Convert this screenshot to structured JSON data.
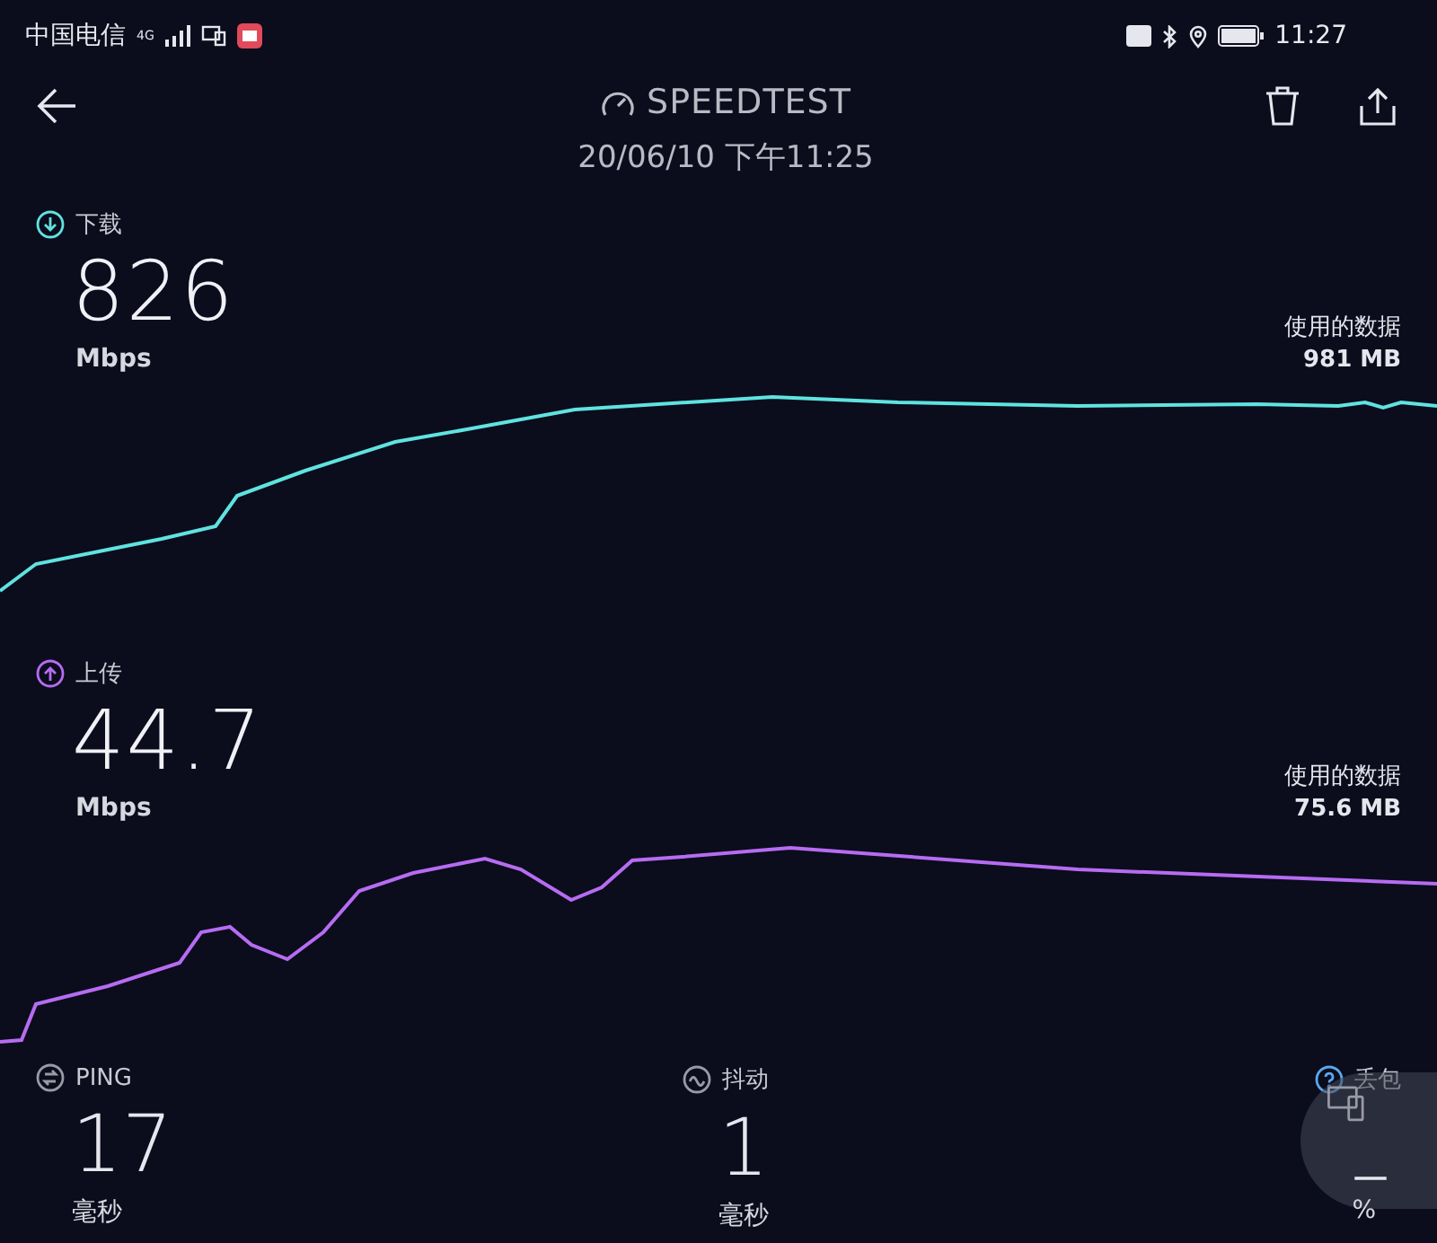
{
  "status_bar": {
    "carrier": "中国电信",
    "network": "4G",
    "time": "11:27"
  },
  "header": {
    "title": "SPEEDTEST",
    "date": "20/06/10 下午11:25"
  },
  "tests": [
    {
      "kind": "download",
      "label": "下载",
      "value": "826",
      "unit": "Mbps",
      "data_label": "使用的数据",
      "data_value": "981 MB",
      "color": "#5fe3e0"
    },
    {
      "kind": "upload",
      "label": "上传",
      "value": "44.7",
      "unit": "Mbps",
      "data_label": "使用的数据",
      "data_value": "75.6 MB",
      "color": "#b66cf2"
    }
  ],
  "metrics": [
    {
      "kind": "ping",
      "label": "PING",
      "value": "17",
      "unit": "毫秒"
    },
    {
      "kind": "jitter",
      "label": "抖动",
      "value": "1",
      "unit": "毫秒"
    },
    {
      "kind": "loss",
      "label": "丢包",
      "value": "–",
      "unit": "%"
    }
  ]
}
